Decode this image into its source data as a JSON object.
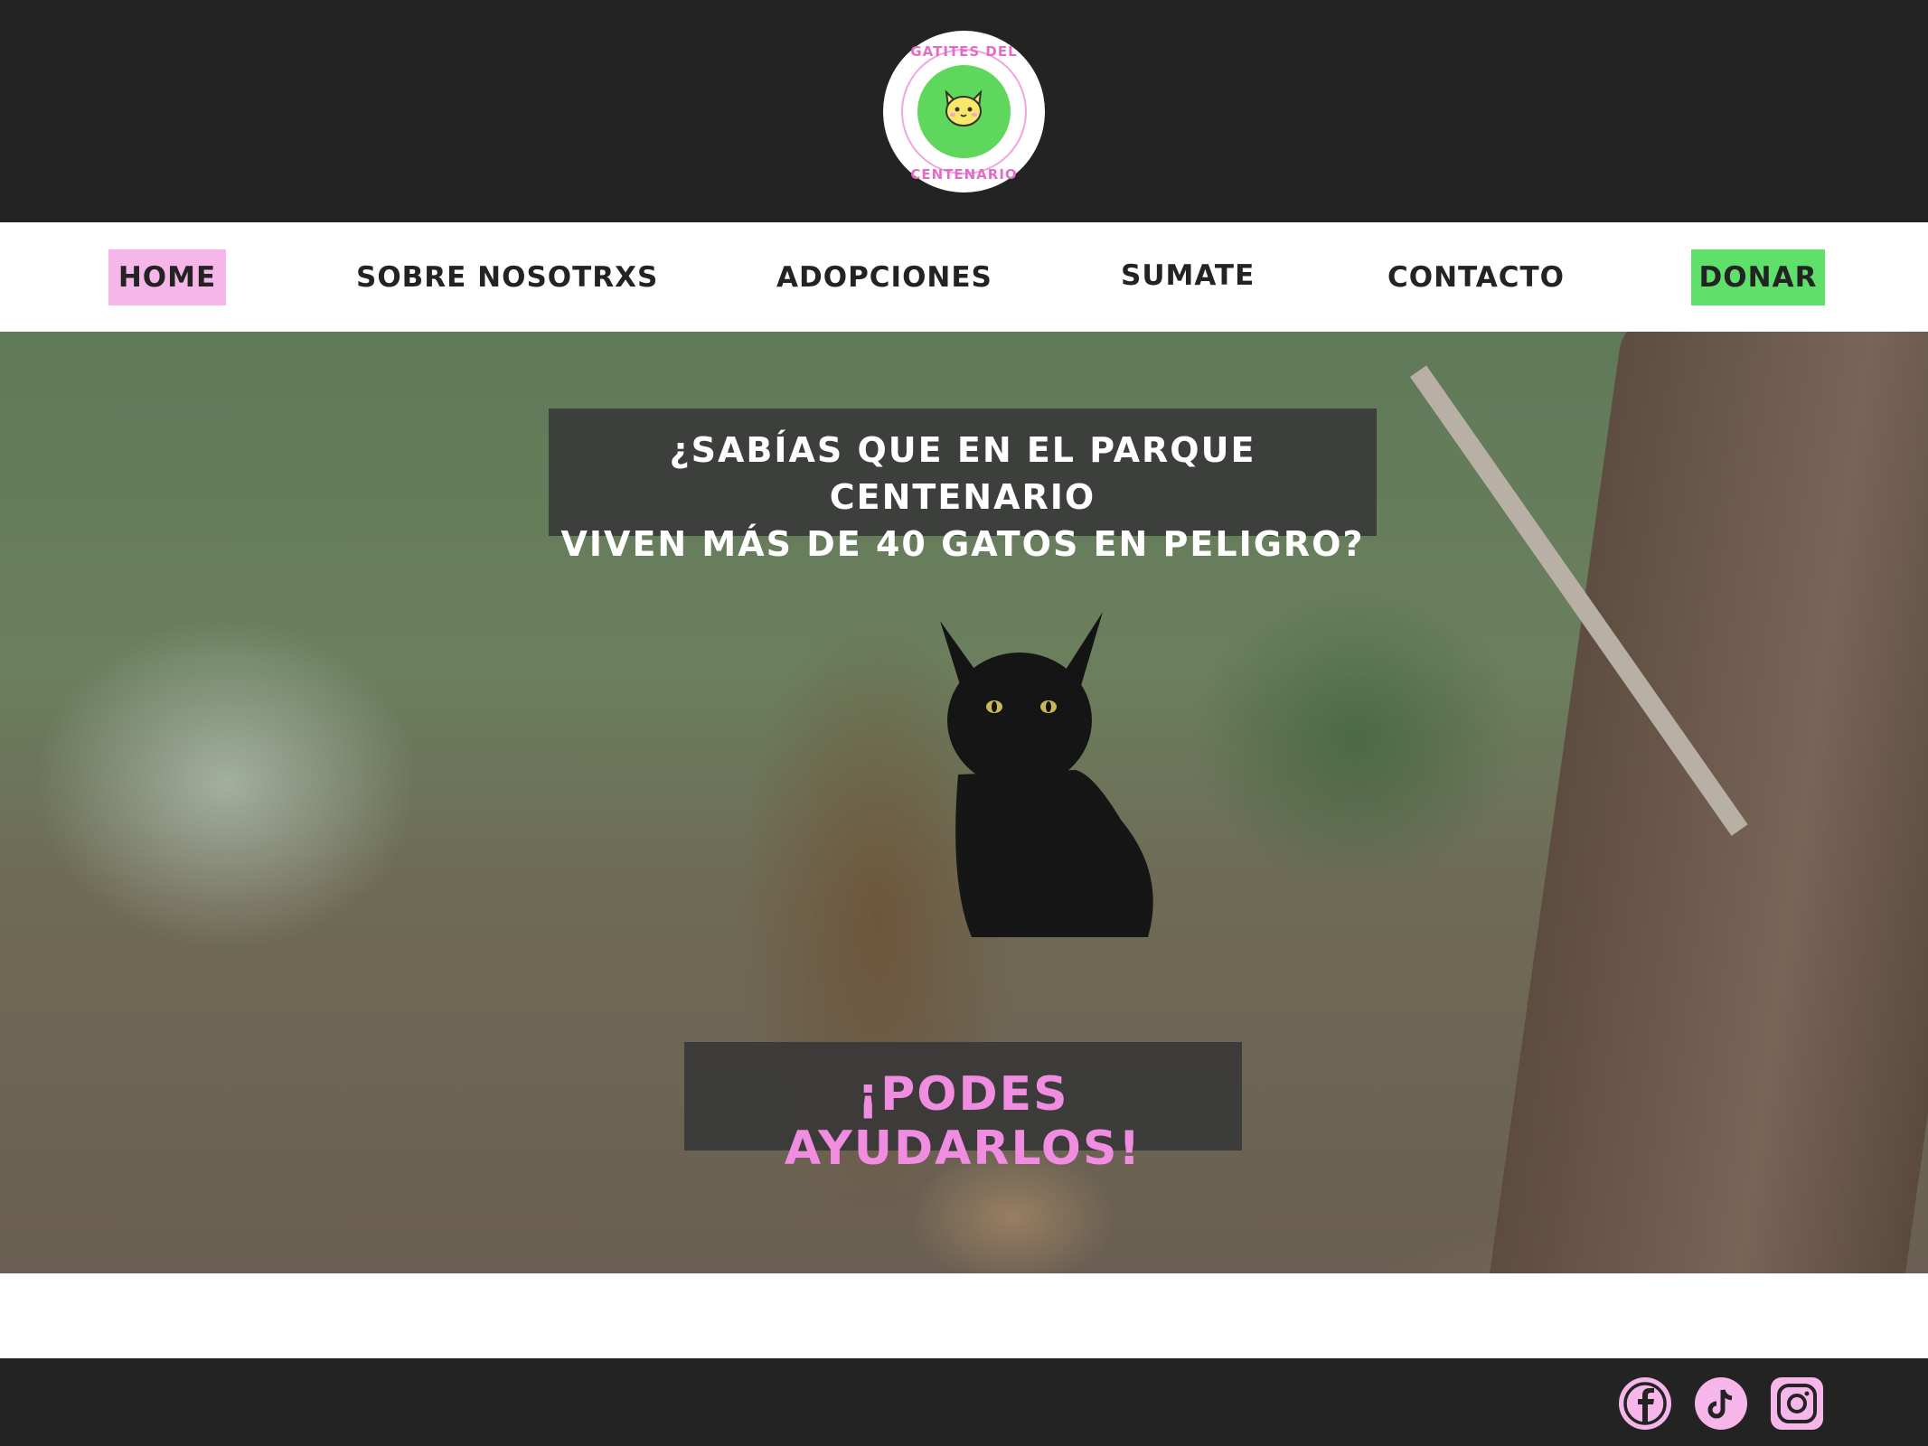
{
  "logo": {
    "text_top": "GATITES DEL",
    "text_bottom": "CENTENARIO",
    "icon": "cat-logo-icon"
  },
  "nav": {
    "items": [
      {
        "label": "HOME",
        "active": true,
        "color": "#f6b6ea"
      },
      {
        "label": "SOBRE NOSOTRXS"
      },
      {
        "label": "ADOPCIONES"
      },
      {
        "label": "SUMATE"
      },
      {
        "label": "CONTACTO"
      },
      {
        "label": "DONAR",
        "color": "#5fe06a"
      }
    ]
  },
  "hero": {
    "question": "¿SABÍAS QUE EN EL PARQUE CENTENARIO\nVIVEN MÁS DE 40 GATOS EN PELIGRO?",
    "cta": "¡PODES AYUDARLOS!",
    "cta_color": "#f08de0"
  },
  "footer": {
    "social": [
      {
        "icon": "facebook-icon"
      },
      {
        "icon": "tiktok-icon"
      },
      {
        "icon": "instagram-icon"
      }
    ],
    "icon_color": "#f6b6ea"
  },
  "colors": {
    "dark": "#232323",
    "pink": "#f6b6ea",
    "green": "#5fe06a"
  }
}
